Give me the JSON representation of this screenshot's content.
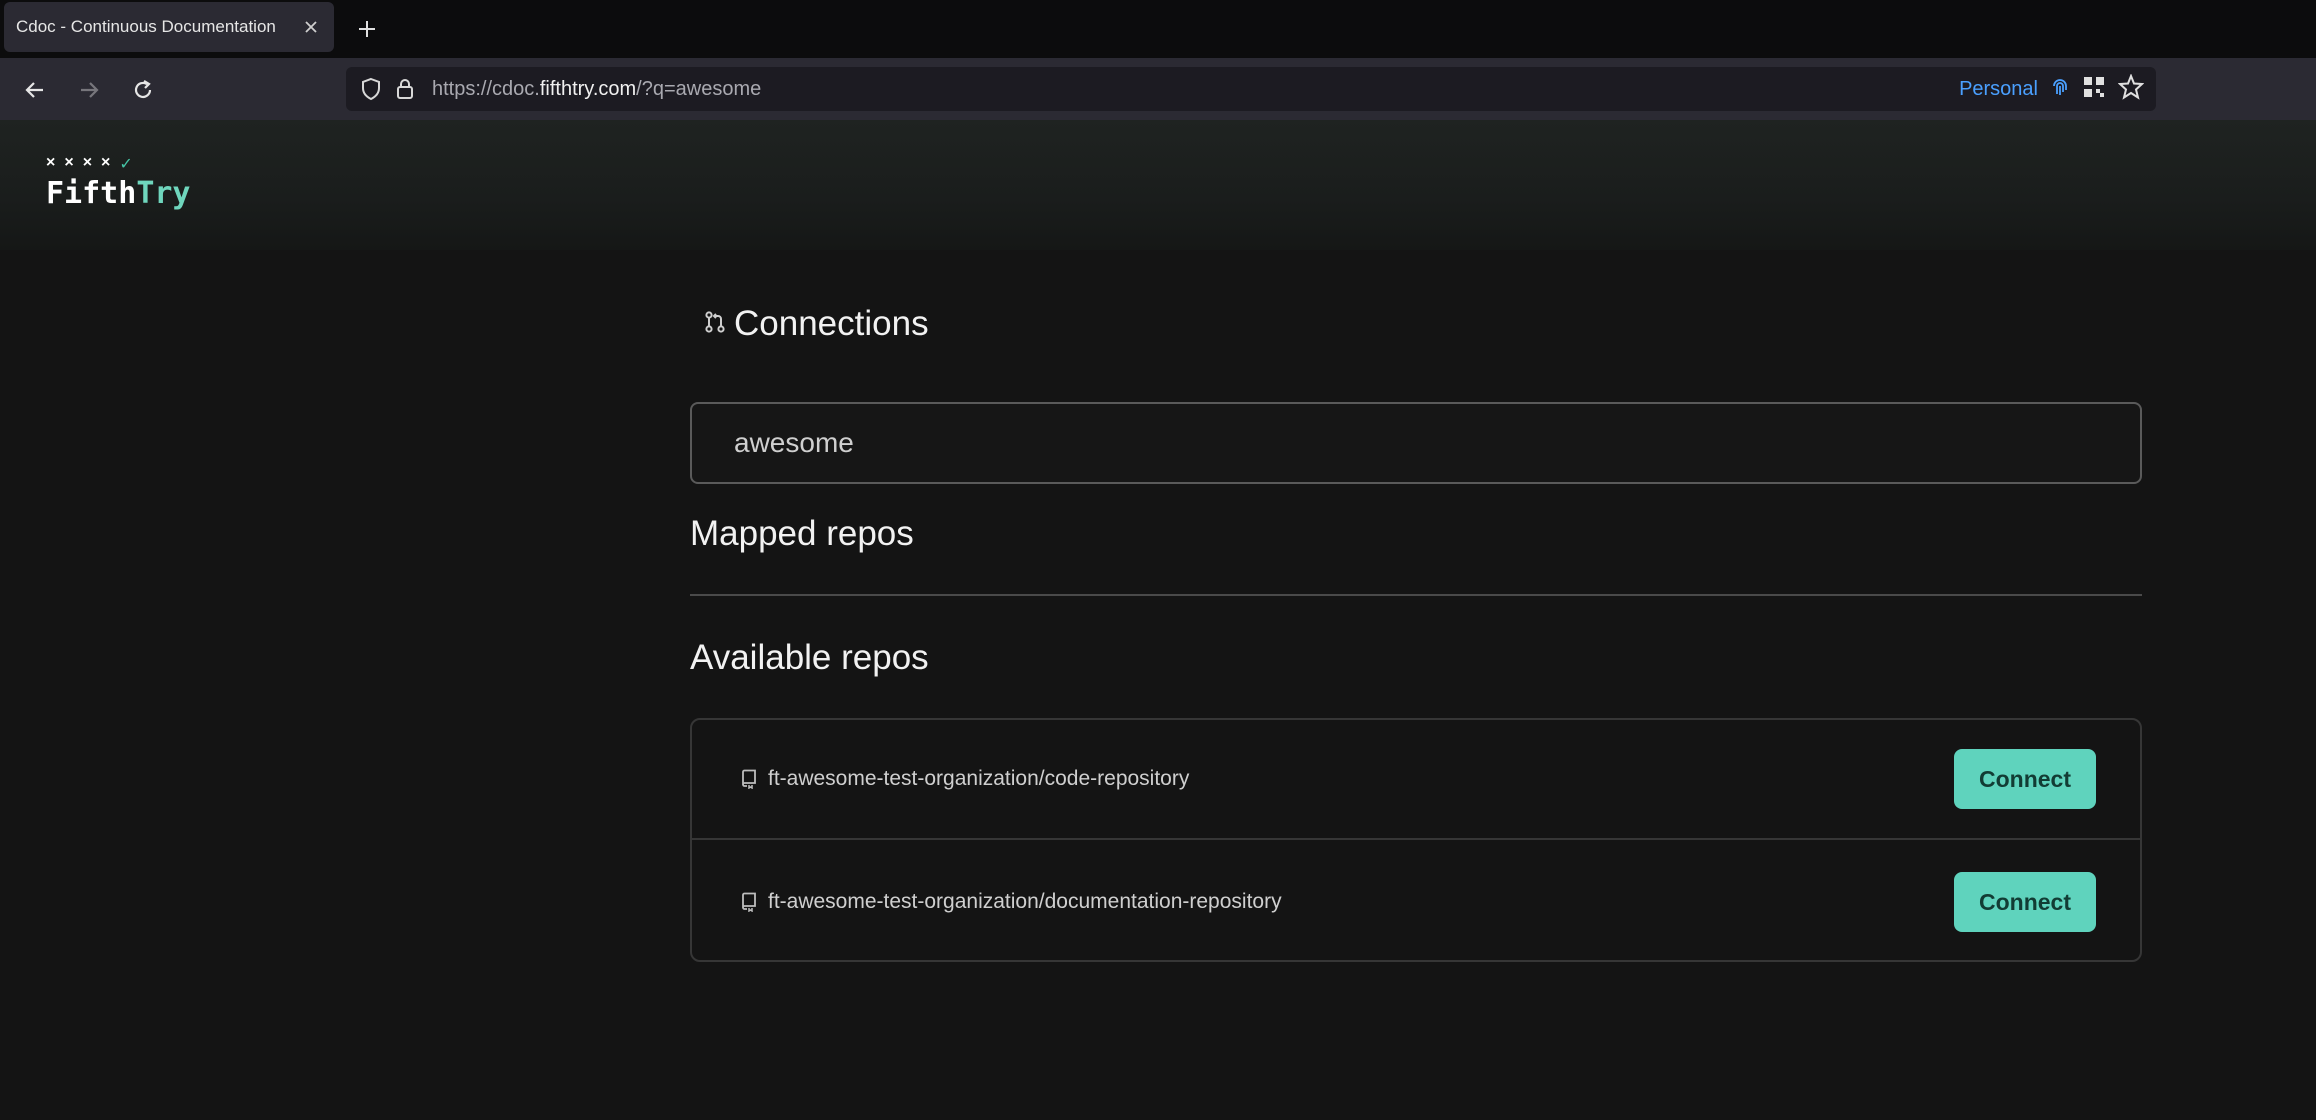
{
  "browser": {
    "tab_title": "Cdoc - Continuous Documentation",
    "url_prefix": "https://cdoc.",
    "url_domain": "fifthtry.com",
    "url_suffix": "/?q=awesome",
    "container_label": "Personal"
  },
  "header": {
    "logo_marks": [
      "×",
      "×",
      "×",
      "×",
      "✓"
    ],
    "logo_text_main": "Fifth",
    "logo_text_accent": "Try"
  },
  "page": {
    "title": "Connections",
    "search_value": "awesome",
    "mapped_title": "Mapped repos",
    "available_title": "Available repos",
    "repos": [
      {
        "name": "ft-awesome-test-organization/code-repository",
        "button": "Connect"
      },
      {
        "name": "ft-awesome-test-organization/documentation-repository",
        "button": "Connect"
      }
    ]
  },
  "colors": {
    "accent": "#5fd3bd",
    "background": "#141414",
    "container_blue": "#4aa0ff"
  }
}
